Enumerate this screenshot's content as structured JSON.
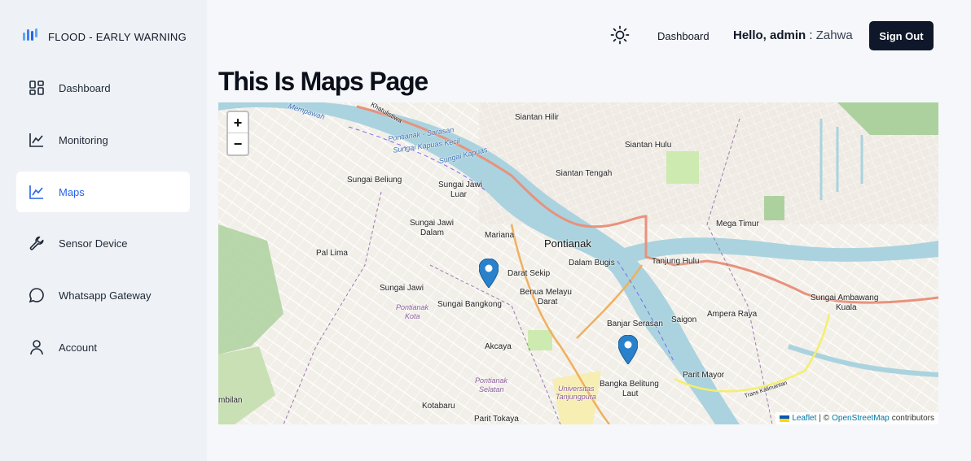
{
  "brand": {
    "title": "FLOOD - EARLY WARNING",
    "icon": "wave-bars-icon"
  },
  "sidebar": {
    "items": [
      {
        "label": "Dashboard",
        "icon": "grid-icon"
      },
      {
        "label": "Monitoring",
        "icon": "line-chart-icon"
      },
      {
        "label": "Maps",
        "icon": "line-chart-icon",
        "active": true
      },
      {
        "label": "Sensor Device",
        "icon": "wrench-icon"
      },
      {
        "label": "Whatsapp Gateway",
        "icon": "chat-bubble-icon"
      },
      {
        "label": "Account",
        "icon": "user-icon"
      }
    ]
  },
  "header": {
    "nav_link": "Dashboard",
    "greeting_bold": "Hello, admin",
    "greeting_sep": " : ",
    "greeting_user": "Zahwa",
    "signout_label": "Sign Out"
  },
  "page": {
    "title": "This Is Maps Page"
  },
  "map": {
    "zoom_in": "+",
    "zoom_out": "−",
    "places": {
      "mempawah": "Mempawah",
      "khatulistiwa": "Khatulistiwa",
      "siantan_hilir": "Siantan Hilir",
      "siantan_hulu": "Siantan Hulu",
      "siantan_tengah": "Siantan Tengah",
      "river_label_1": "Pontianak - Sarasan",
      "river_label_2": "Sungai Kapuas Kecil",
      "river_label_3": "Sungai Kapuas",
      "sungai_beliung": "Sungai Beliung",
      "sungai_jawi_luar_1": "Sungai Jawi",
      "sungai_jawi_luar_2": "Luar",
      "sungai_jawi_dalam_1": "Sungai Jawi",
      "sungai_jawi_dalam_2": "Dalam",
      "mariana": "Mariana",
      "pontianak": "Pontianak",
      "dalam_bugis": "Dalam Bugis",
      "mega_timur": "Mega Timur",
      "pal_lima": "Pal Lima",
      "tanjung_hulu": "Tanjung Hulu",
      "darat_sekip": "Darat Sekip",
      "sungai_jawi": "Sungai Jawi",
      "benua_melayu_1": "Benua Melayu",
      "benua_melayu_2": "Darat",
      "pontianak_kota_1": "Pontianak",
      "pontianak_kota_2": "Kota",
      "sungai_bangkong": "Sungai Bangkong",
      "ampera_raya": "Ampera Raya",
      "sungai_ambawang_1": "Sungai Ambawang",
      "sungai_ambawang_2": "Kuala",
      "banjar_serasan": "Banjar Serasan",
      "saigon": "Saigon",
      "akcaya": "Akcaya",
      "parit_mayor": "Parit Mayor",
      "pontianak_selatan_1": "Pontianak",
      "pontianak_selatan_2": "Selatan",
      "bangka_belitung_1": "Bangka Belitung",
      "bangka_belitung_2": "Laut",
      "univ_1": "Universitas",
      "univ_2": "Tanjungpura",
      "trans_kalimantan": "Trans Kalimantan",
      "mbilan": "mbilan",
      "kotabaru": "Kotabaru",
      "parit_tokaya": "Parit Tokaya"
    },
    "markers": [
      {
        "name": "marker-1",
        "color": "#2a81cb"
      },
      {
        "name": "marker-2",
        "color": "#2a81cb"
      }
    ],
    "attribution": {
      "leaflet": "Leaflet",
      "sep": "| ©",
      "osm": "OpenStreetMap",
      "contributors": "contributors"
    }
  },
  "colors": {
    "accent": "#2563eb",
    "button_bg": "#0f172a",
    "river": "#aad3df",
    "major_road": "#e8927c"
  }
}
